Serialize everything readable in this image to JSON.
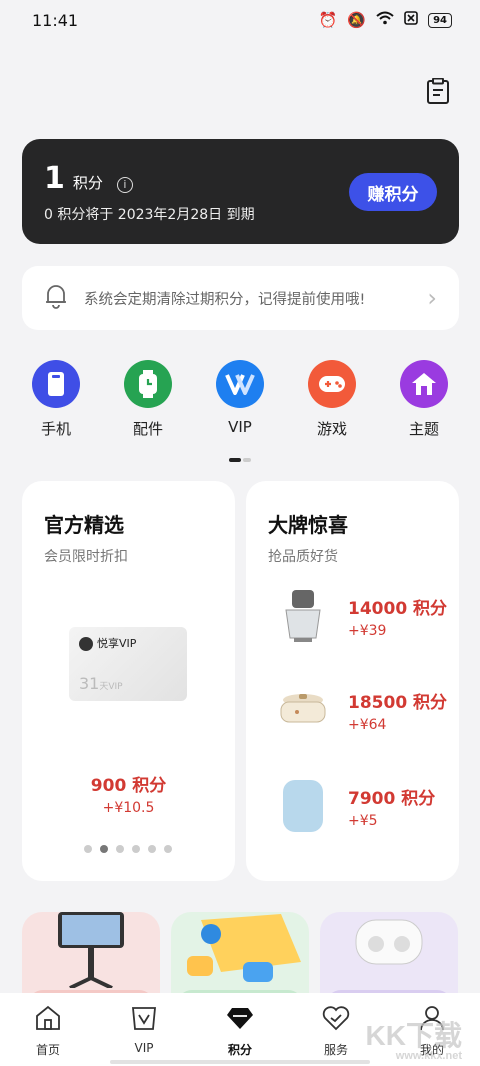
{
  "status_bar": {
    "time": "11:41",
    "battery": "94"
  },
  "points_card": {
    "points": "1",
    "unit": "积分",
    "expire_text": "0 积分将于 2023年2月28日 到期",
    "earn_button": "赚积分"
  },
  "notice": {
    "text": "系统会定期清除过期积分，记得提前使用哦!"
  },
  "categories": [
    {
      "label": "手机",
      "icon": "phone-icon",
      "color": "#3f4ee6"
    },
    {
      "label": "配件",
      "icon": "watch-icon",
      "color": "#26a352"
    },
    {
      "label": "VIP",
      "icon": "vip-icon",
      "color": "#1e7ff0"
    },
    {
      "label": "游戏",
      "icon": "gamepad-icon",
      "color": "#f25a3a"
    },
    {
      "label": "主题",
      "icon": "home-theme-icon",
      "color": "#9a3be0"
    }
  ],
  "official": {
    "title": "官方精选",
    "subtitle": "会员限时折扣",
    "vip_card_brand": "悦享VIP",
    "vip_card_days": "31",
    "vip_card_days_unit": "天VIP",
    "offer_points": "900 积分",
    "offer_price": "+¥10.5"
  },
  "brand": {
    "title": "大牌惊喜",
    "subtitle": "抢品质好货",
    "products": [
      {
        "points": "14000 积分",
        "price": "+¥39",
        "icon": "food-processor-icon"
      },
      {
        "points": "18500 积分",
        "price": "+¥64",
        "icon": "hot-pot-icon"
      },
      {
        "points": "7900 积分",
        "price": "+¥5",
        "icon": "speaker-icon"
      }
    ]
  },
  "tabs": [
    {
      "label": "首页",
      "icon": "home-icon",
      "active": false
    },
    {
      "label": "VIP",
      "icon": "vip-badge-icon",
      "active": false
    },
    {
      "label": "积分",
      "icon": "diamond-icon",
      "active": true
    },
    {
      "label": "服务",
      "icon": "heart-service-icon",
      "active": false
    },
    {
      "label": "我的",
      "icon": "profile-icon",
      "active": false
    }
  ],
  "watermark": {
    "main": "KK下载",
    "sub": "www.kkx.net"
  }
}
